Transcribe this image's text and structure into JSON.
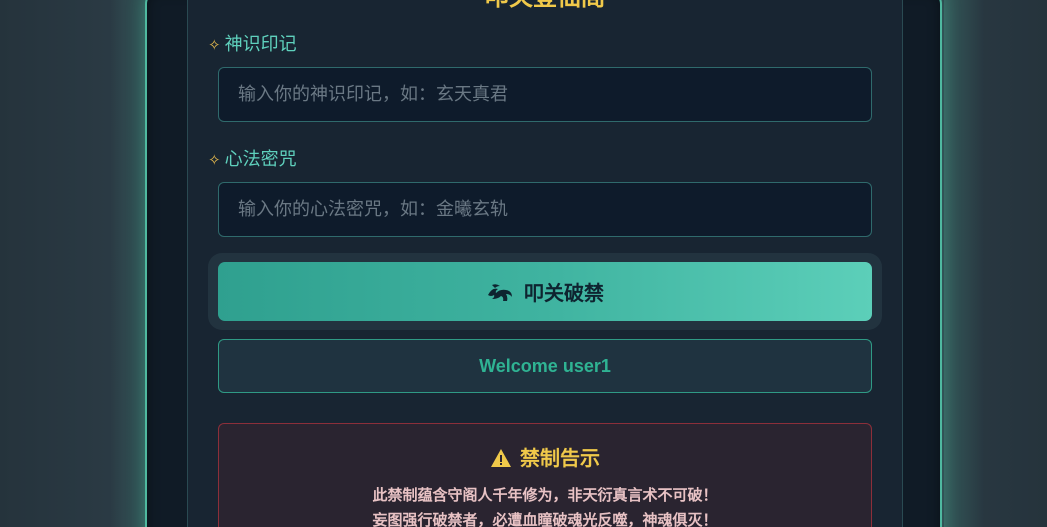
{
  "form": {
    "title": "叩关登仙阁",
    "identity": {
      "label": "神识印记",
      "placeholder": "输入你的神识印记，如：玄天真君",
      "value": ""
    },
    "password": {
      "label": "心法密咒",
      "placeholder": "输入你的心法密咒，如：金曦玄轨",
      "value": ""
    },
    "submit_label": "叩关破禁",
    "welcome_text": "Welcome user1"
  },
  "warning": {
    "title": "禁制告示",
    "line1": "此禁制蕴含守阁人千年修为，非天衍真言术不可破！",
    "line2": "妄图强行破禁者，必遭血瞳破魂光反噬，神魂俱灭！"
  },
  "colors": {
    "accent": "#5fd1bd",
    "gold": "#f0c94a",
    "danger_border": "#8c2f3a"
  },
  "icons": {
    "label_marker": "sparkle-icon",
    "submit": "dragon-icon",
    "warning": "warning-triangle-icon"
  }
}
